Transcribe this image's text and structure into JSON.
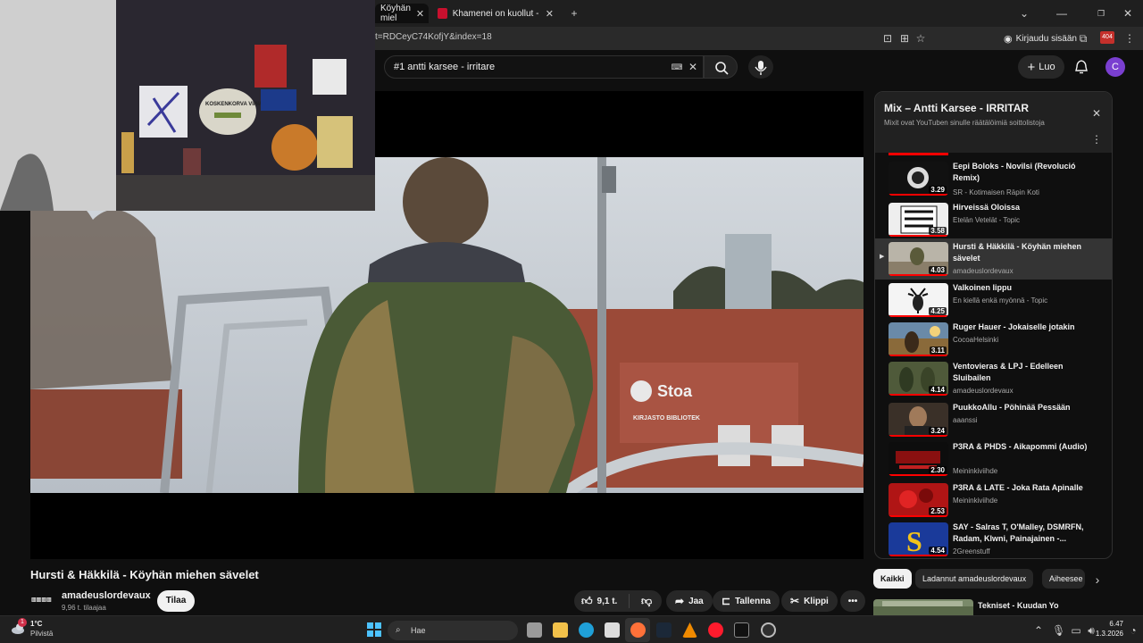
{
  "browser": {
    "tabs": [
      {
        "label": "Köyhän miel",
        "active": true
      },
      {
        "label": "Khamenei on kuollut - Tämä tie",
        "active": false
      }
    ],
    "new_tab_symbol": "+",
    "url": "t=RDCeyC74KofjY&index=18",
    "signin_label": "Kirjaudu sisään"
  },
  "youtube": {
    "search_value": "#1 antti karsee - irritare",
    "create_label": "Luo",
    "avatar_letter": "C"
  },
  "video": {
    "title": "Hursti & Häkkilä - Köyhän miehen sävelet",
    "channel": "amadeuslordevaux",
    "subscribers": "9,96 t. tilaajaa",
    "subscribe_label": "Tilaa",
    "likes": "9,1 t.",
    "share_label": "Jaa",
    "save_label": "Tallenna",
    "clip_label": "Klippi",
    "sign_text": "Stoa",
    "sign_sub": "KIRJASTO BIBLIOTEK"
  },
  "webcam": {
    "sticker_text": "KOSKENKORVA VIINA"
  },
  "playlist": {
    "title": "Mix – Antti Karsee - IRRITAR",
    "subtitle": "Mixit ovat YouTuben sinulle räätälöimiä soittolistoja",
    "items": [
      {
        "title": "Eepi Boloks - Novilsi (Revolució Remix)",
        "channel": "SR - Kotimaisen Räpin Koti",
        "duration": "3.29",
        "active": false
      },
      {
        "title": "Hirveissä Oloissa",
        "channel": "Etelän Vetelät - Topic",
        "duration": "3.58",
        "active": false
      },
      {
        "title": "Hursti & Häkkilä - Köyhän miehen sävelet",
        "channel": "amadeuslordevaux",
        "duration": "4.03",
        "active": true
      },
      {
        "title": "Valkoinen lippu",
        "channel": "En kiellä enkä myönnä - Topic",
        "duration": "4.25",
        "active": false
      },
      {
        "title": "Ruger Hauer - Jokaiselle jotakin",
        "channel": "CocoaHelsinki",
        "duration": "3.11",
        "active": false
      },
      {
        "title": "Ventovieras & LPJ - Edelleen Sluibailen",
        "channel": "amadeuslordevaux",
        "duration": "4.14",
        "active": false
      },
      {
        "title": "PuukkoAllu - Pöhinää Pessään",
        "channel": "aaanssi",
        "duration": "3.24",
        "active": false
      },
      {
        "title": "P3RA & PHDS - Aikapommi (Audio)",
        "channel": "Meininkiviihde",
        "duration": "2.30",
        "active": false
      },
      {
        "title": "P3RA & LATE - Joka Rata Apinalle",
        "channel": "Meininkiviihde",
        "duration": "2.53",
        "active": false
      },
      {
        "title": "SAY - Salras T, O'Malley, DSMRFN, Radam, Klwni, Painajainen -...",
        "channel": "2Greenstuff",
        "duration": "4.54",
        "active": false
      }
    ]
  },
  "chips": [
    "Kaikki",
    "Ladannut amadeuslordevaux",
    "Aiheesee"
  ],
  "next_item": {
    "title": "Tekniset - Kuudan Yo"
  },
  "taskbar": {
    "weather_temp": "1°C",
    "weather_desc": "Pilvistä",
    "search_label": "Hae",
    "time": "6.47",
    "date": "1.3.2026",
    "notif_count": "1"
  },
  "colors": {
    "accent": "#ff0000",
    "bg": "#0f0f0f",
    "avatar": "#7a3fd0"
  }
}
